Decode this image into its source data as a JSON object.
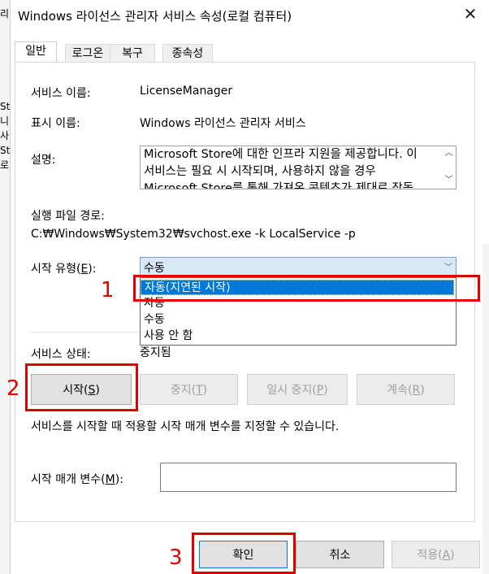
{
  "window": {
    "title": "Windows 라이선스 관리자 서비스 속성(로컬 컴퓨터)"
  },
  "background_window": {
    "left_text": [
      "리",
      "",
      "",
      "",
      "",
      "",
      "St",
      "니",
      "사",
      "St",
      "로"
    ]
  },
  "tabs": [
    "일반",
    "로그온",
    "복구",
    "종속성"
  ],
  "general": {
    "service_name_label": "서비스 이름:",
    "service_name": "LicenseManager",
    "display_name_label": "표시 이름:",
    "display_name": "Windows 라이선스 관리자 서비스",
    "description_label": "설명:",
    "description_lines": [
      "Microsoft Store에 대한 인프라 지원을 제공합니다. 이",
      "서비스는 필요 시 시작되며, 사용하지 않을 경우",
      "Microsoft Store를 통해 가져온 콘텐츠가 제대로 작동"
    ],
    "exe_path_label": "실행 파일 경로:",
    "exe_path": "C:₩Windows₩System32₩svchost.exe -k LocalService -p",
    "startup_type_label_text": "시작 유형(",
    "startup_type_label_key": "E",
    "startup_type_label_end": "):",
    "startup_type_value": "수동",
    "startup_options": [
      "자동(지연된 시작)",
      "자동",
      "수동",
      "사용 안 함"
    ],
    "status_label": "서비스 상태:",
    "status_value": "중지됨",
    "buttons": {
      "start": {
        "text": "시작(",
        "key": "S",
        "end": ")"
      },
      "stop": {
        "text": "중지(",
        "key": "T",
        "end": ")"
      },
      "pause": {
        "text": "일시 중지(",
        "key": "P",
        "end": ")"
      },
      "resume": {
        "text": "계속(",
        "key": "R",
        "end": ")"
      }
    },
    "start_params_hint": "서비스를 시작할 때 적용할 시작 매개 변수를 지정할 수 있습니다.",
    "start_params_label_text": "시작 매개 변수(",
    "start_params_label_key": "M",
    "start_params_label_end": "):",
    "start_params_value": ""
  },
  "footer": {
    "ok": "확인",
    "cancel": "취소",
    "apply_text": "적용(",
    "apply_key": "A",
    "apply_end": ")"
  },
  "annotations": {
    "marker1": "1",
    "marker2": "2",
    "marker3": "3",
    "color": "#e00000"
  }
}
